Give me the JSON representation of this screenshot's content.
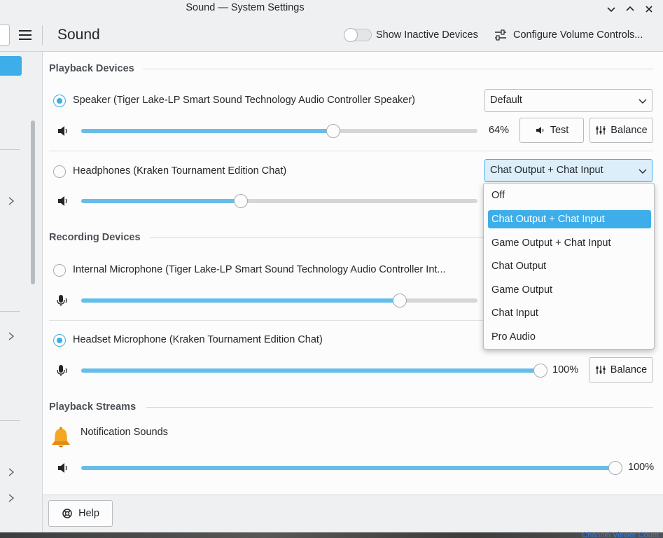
{
  "window": {
    "title": "Sound — System Settings",
    "buttons": [
      "minimize",
      "maximize",
      "close"
    ]
  },
  "toolbar": {
    "page_title": "Sound",
    "show_inactive_label": "Show Inactive Devices",
    "show_inactive_on": false,
    "configure_label": "Configure Volume Controls..."
  },
  "sections": {
    "playback": "Playback Devices",
    "recording": "Recording Devices",
    "streams": "Playback Streams"
  },
  "playback_devices": [
    {
      "label": "Speaker (Tiger Lake-LP Smart Sound Technology Audio Controller Speaker)",
      "selected": true,
      "volume": 64,
      "percent_label": "64%",
      "profile": "Default",
      "test_label": "Test",
      "balance_label": "Balance"
    },
    {
      "label": "Headphones (Kraken Tournament Edition Chat)",
      "selected": false,
      "volume": 38,
      "profile": "Chat Output + Chat Input"
    }
  ],
  "recording_devices": [
    {
      "label": "Internal Microphone (Tiger Lake-LP Smart Sound Technology Audio Controller Int...",
      "selected": false,
      "volume": 80
    },
    {
      "label": "Headset Microphone (Kraken Tournament Edition Chat)",
      "selected": true,
      "volume": 100,
      "percent_label": "100%",
      "balance_label": "Balance"
    }
  ],
  "streams": [
    {
      "label": "Notification Sounds",
      "icon": "bell-icon",
      "volume": 100,
      "percent_label": "100%"
    }
  ],
  "profile_menu": {
    "options": [
      "Off",
      "Chat Output + Chat Input",
      "Game Output + Chat Input",
      "Chat Output",
      "Game Output",
      "Chat Input",
      "Pro Audio"
    ],
    "selected": "Chat Output + Chat Input"
  },
  "footer": {
    "help_label": "Help"
  },
  "background_text": "Channel Viewer Count",
  "colors": {
    "accent": "#3daee9",
    "slider_fill": "#66bde9",
    "window_bg": "#eff0f1",
    "content_bg": "#fcfcfc"
  }
}
